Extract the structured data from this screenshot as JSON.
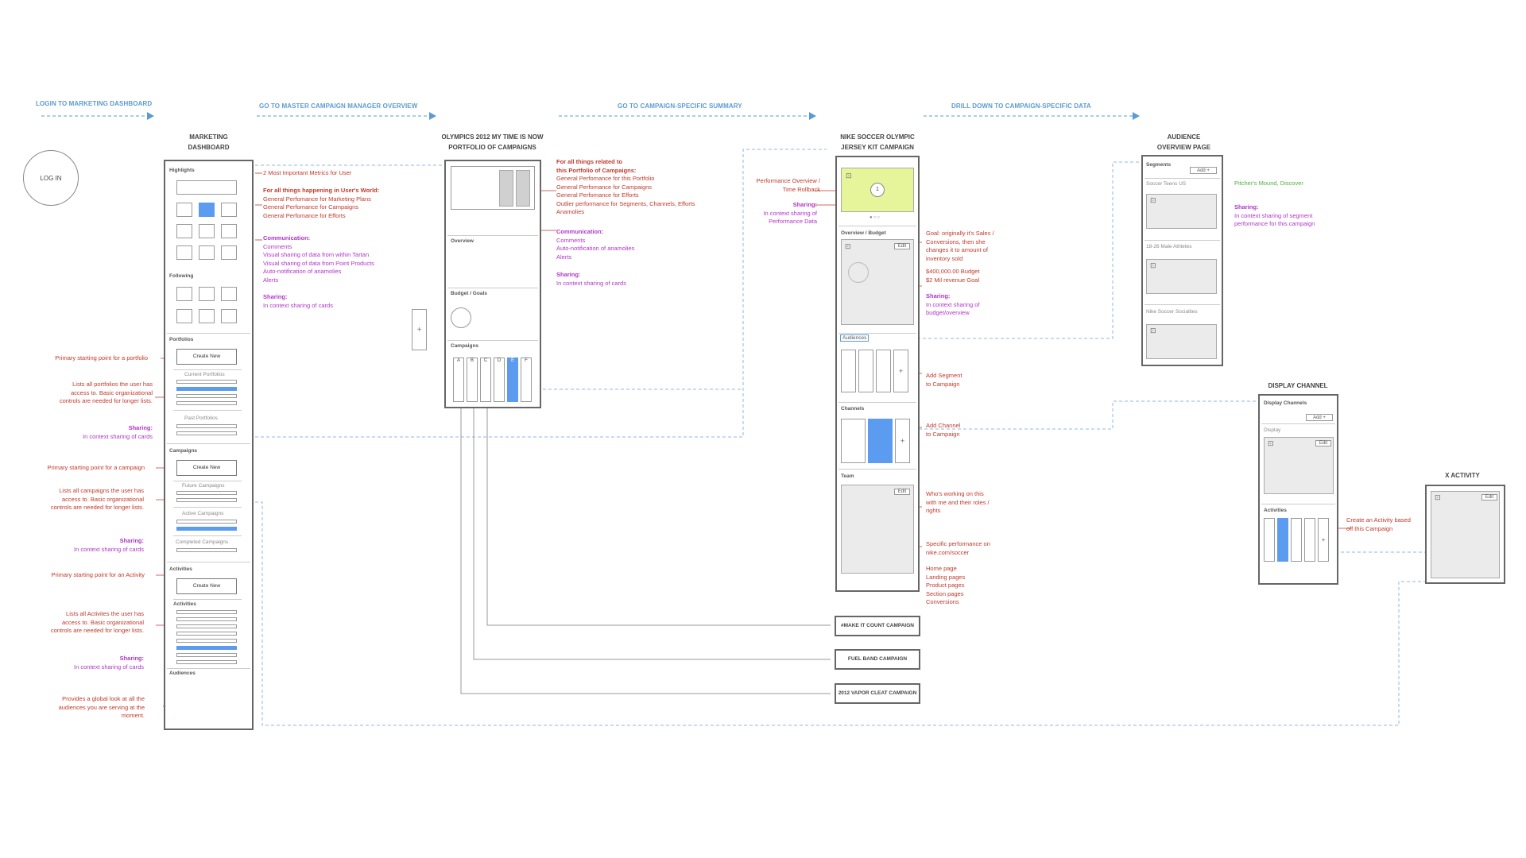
{
  "steps": [
    "LOGIN TO MARKETING DASHBOARD",
    "GO TO MASTER CAMPAIGN MANAGER OVERVIEW",
    "GO TO CAMPAIGN-SPECIFIC SUMMARY",
    "DRILL DOWN TO CAMPAIGN-SPECIFIC DATA"
  ],
  "login": "LOG IN",
  "dashboard": {
    "title1": "MARKETING",
    "title2": "DASHBOARD",
    "highlights": "Highlights",
    "following": "Following",
    "portfolios": "Portfolios",
    "create_new": "Create New",
    "current_portfolios": "Current Portfolios",
    "past_portfolios": "Past Portfolios",
    "campaigns": "Campaigns",
    "future_campaigns": "Future Campaigns",
    "active_campaigns": "Active Campaigns",
    "completed_campaigns": "Completed Campaigns",
    "activities_section": "Activities",
    "activities": "Activities",
    "audiences": "Audiences"
  },
  "dash_notes_right": {
    "metrics": "2 Most Important Metrics for User",
    "world_title": "For all things happening in User's World:",
    "world": [
      "General Perfomance for Marketing Plans",
      "General Perfomance for Campaigns",
      "General Perfomance for Efforts"
    ],
    "comm_title": "Communication:",
    "comm": [
      "Comments",
      "Visual sharing of data from within Tartan",
      "Visual sharing of data from Point Products",
      "Auto-notification of anamolies",
      "Alerts"
    ],
    "share_title": "Sharing:",
    "share": "In context sharing of cards"
  },
  "dash_notes_left": {
    "portfolio_start": "Primary starting point for a portfolio",
    "portfolio_list": [
      "Lists all portfolios the user has",
      "access to. Basic organizational",
      "controls are needed for longer lists."
    ],
    "share1_title": "Sharing:",
    "share1": "In context sharing of cards",
    "campaign_start": "Primary starting point for a campaign",
    "campaign_list": [
      "Lists all campaigns the user has",
      "access to. Basic organizational",
      "controls are needed for longer lists."
    ],
    "share2_title": "Sharing:",
    "share2": "In context sharing of cards",
    "activity_start": "Primary starting point for an Activity",
    "activity_list": [
      "Lists all Activites the user has",
      "access to. Basic organizational",
      "controls are needed for longer lists."
    ],
    "share3_title": "Sharing:",
    "share3": "In context sharing of cards",
    "audiences": [
      "Provides a global look at all the",
      "audiences you are serving at the",
      "moment."
    ]
  },
  "portfolio": {
    "title1": "OLYMPICS 2012  MY TIME IS NOW",
    "title2": "PORTFOLIO OF CAMPAIGNS",
    "overview": "Overview",
    "budget": "Budget / Goals",
    "campaigns": "Campaigns",
    "cols": [
      "A",
      "B",
      "C",
      "D",
      "E",
      "F"
    ],
    "add": "+"
  },
  "portfolio_notes": {
    "title1": "For all things related to",
    "title2": "this Portfolio of Campaigns:",
    "items": [
      "General Perfomance for this Portfolio",
      "General Perfomance for Campaigns",
      "General Perfomance for Efforts",
      "Outlier performance for Segments, Channels, Efforts",
      "Anamolies"
    ],
    "comm_title": "Communication:",
    "comm": [
      "Comments",
      "Auto-notification of anamolies",
      " Alerts"
    ],
    "share_title": "Sharing:",
    "share": "In context sharing of cards"
  },
  "campaign": {
    "title1": "NIKE SOCCER OLYMPIC",
    "title2": "JERSEY KIT CAMPAIGN",
    "badge": "1",
    "overview": "Overview / Budget",
    "edit": "Edit",
    "audiences": "Audiences",
    "channels": "Channels",
    "team": "Team",
    "add": "+"
  },
  "campaign_notes_left": {
    "perf": [
      "Performance Overview /",
      "Time Rollback"
    ],
    "share_title": "Sharing:",
    "share": [
      "In context sharing of",
      "Performance Data"
    ]
  },
  "campaign_notes_right": {
    "goal": [
      "Goal: originally it's Sales /",
      "Conversions, then she",
      "changes it to amount of",
      "inventory sold"
    ],
    "budget": [
      "$400,000.00 Budget",
      "$2 Mil revenue Goal"
    ],
    "share_title": "Sharing:",
    "share": [
      "In context sharing of",
      "budget/overview"
    ],
    "segment": [
      "Add Segment",
      "to Campaign"
    ],
    "channel": [
      "Add Channel",
      "to Campaign"
    ],
    "team": [
      "Who's working on this",
      "with me and their roles /",
      "rights"
    ],
    "specific": [
      "Specific performance on",
      "nike.com/soccer"
    ],
    "pages": [
      "Home page",
      "Landing pages",
      "Product pages",
      "Section pages",
      "Conversions"
    ]
  },
  "other_campaigns": [
    "#MAKE IT COUNT CAMPAIGN",
    "FUEL BAND CAMPAIGN",
    "2012 VAPOR CLEAT CAMPAIGN"
  ],
  "audience": {
    "title1": "AUDIENCE",
    "title2": "OVERVIEW PAGE",
    "segments": "Segments",
    "add": "Add +",
    "seg1": "Soccer Teens US",
    "seg2": "18-26 Male Athletes",
    "seg3": "Nike Soccer Socialites"
  },
  "audience_notes": {
    "pitch": "Pitcher's Mound, Discover",
    "share_title": "Sharing:",
    "share": [
      "In context sharing of segment",
      "performance for this campaign"
    ]
  },
  "display": {
    "title": "DISPLAY CHANNEL",
    "channels": "Display Channels",
    "add": "Add +",
    "display": "Display",
    "edit": "Edit",
    "activities": "Activities",
    "plus": "+"
  },
  "display_note": [
    "Create an Activity based",
    "off this Campaign"
  ],
  "activity": {
    "title": "X ACTIVITY",
    "edit": "Edit"
  },
  "colors": {
    "arrow": "#5b9bd5",
    "note": "#c0392b",
    "sharing": "#b035c9",
    "highlight": "#e6f59a",
    "blue": "#5b9bf0"
  }
}
